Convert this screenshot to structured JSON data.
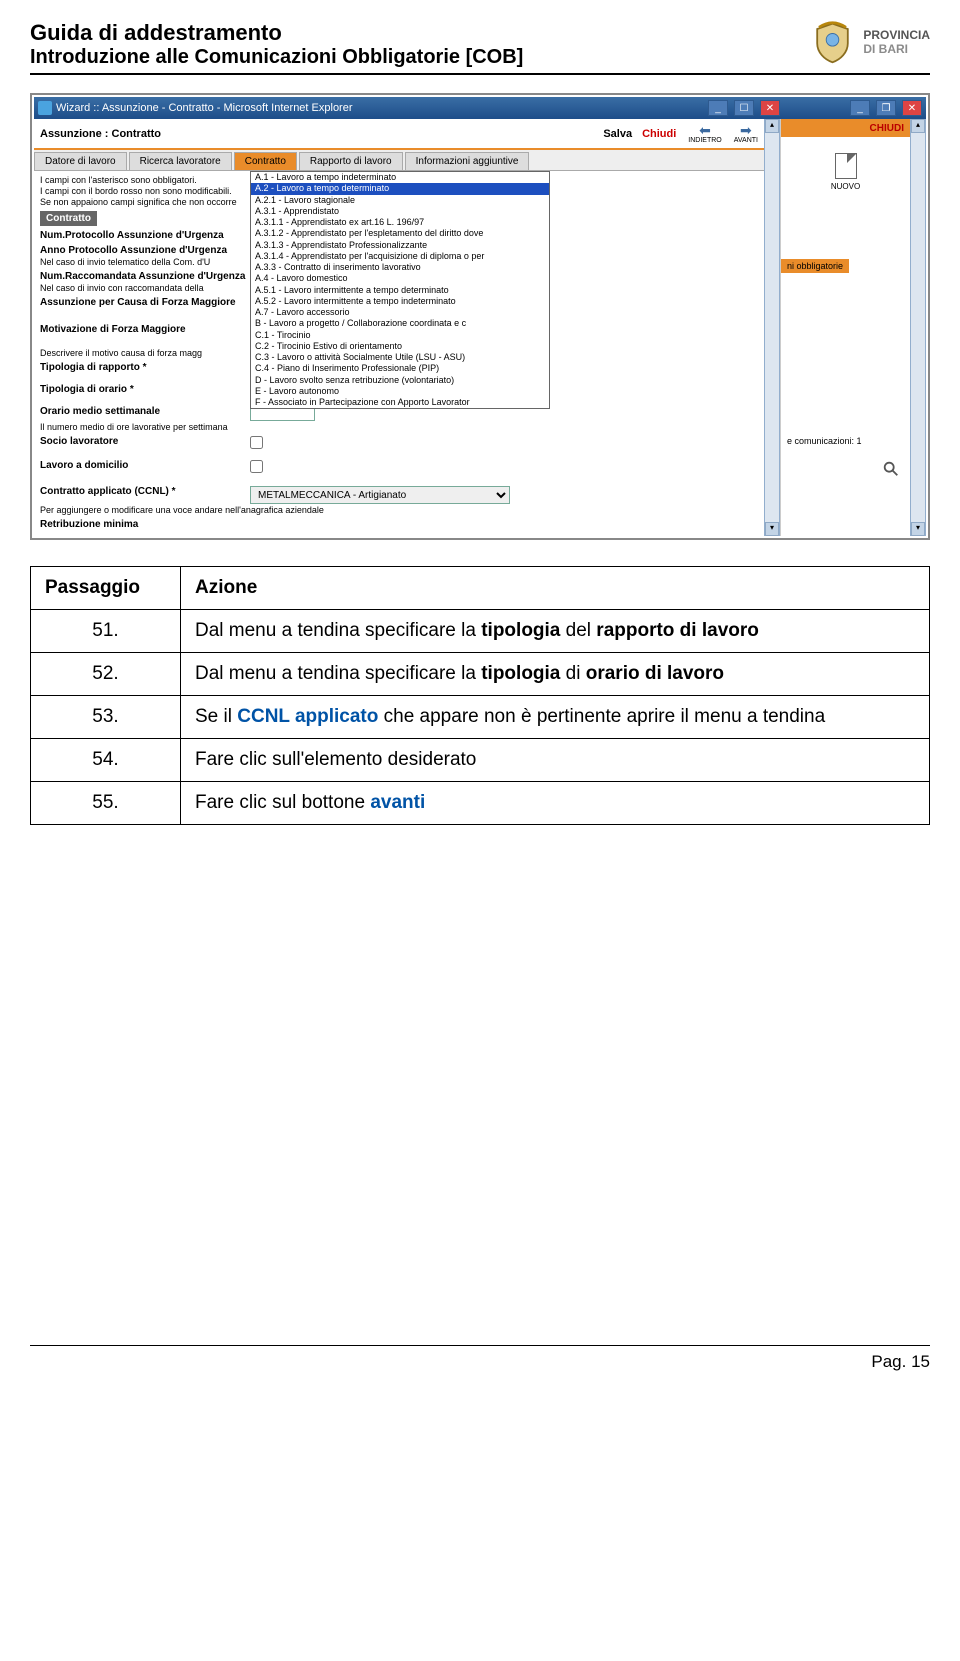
{
  "header": {
    "title": "Guida di addestramento",
    "subtitle": "Introduzione alle Comunicazioni Obbligatorie [COB]",
    "org_line1": "PROVINCIA",
    "org_line2": "DI BARI"
  },
  "screenshot": {
    "window_title": "Wizard :: Assunzione - Contratto - Microsoft Internet Explorer",
    "breadcrumb": "Assunzione : Contratto",
    "actions": {
      "salva": "Salva",
      "chiudi": "Chiudi",
      "indietro": "INDIETRO",
      "avanti": "AVANTI"
    },
    "tabs": [
      "Datore di lavoro",
      "Ricerca lavoratore",
      "Contratto",
      "Rapporto di lavoro",
      "Informazioni aggiuntive"
    ],
    "active_tab": "Contratto",
    "hints": [
      "I campi con l'asterisco sono obbligatori.",
      "I campi con il bordo rosso non sono modificabili.",
      "Se non appaiono campi significa che non occorre"
    ],
    "section": "Contratto",
    "fields": {
      "num_protocollo": {
        "label": "Num.Protocollo Assunzione d'Urgenza"
      },
      "anno_protocollo": {
        "label": "Anno Protocollo Assunzione d'Urgenza"
      },
      "note_telematico": "Nel caso di invio telematico della Com. d'U",
      "num_raccomandata": {
        "label": "Num.Raccomandata Assunzione d'Urgenza"
      },
      "note_raccomandata": "Nel caso di invio con raccomandata della",
      "forza_maggiore": {
        "label": "Assunzione per Causa di Forza Maggiore"
      },
      "motivazione": {
        "label": "Motivazione di Forza Maggiore"
      },
      "descrivere": "Descrivere il motivo causa di forza magg",
      "tipologia_rapporto": {
        "label": "Tipologia di rapporto *"
      },
      "tipologia_orario": {
        "label": "Tipologia di orario *"
      },
      "orario_medio": {
        "label": "Orario medio settimanale"
      },
      "orario_note": "Il numero medio di ore lavorative per settimana",
      "socio": {
        "label": "Socio lavoratore"
      },
      "domicilio": {
        "label": "Lavoro a domicilio"
      },
      "ccnl": {
        "label": "Contratto applicato (CCNL) *",
        "value": "METALMECCANICA - Artigianato"
      },
      "ccnl_note": "Per aggiungere o modificare una voce andare nell'anagrafica aziendale",
      "retribuzione": {
        "label": "Retribuzione minima"
      }
    },
    "dropdown_options": [
      "A.1 - Lavoro a tempo indeterminato",
      "A.2 - Lavoro a tempo determinato",
      "A.2.1 - Lavoro stagionale",
      "A.3.1 - Apprendistato",
      "A.3.1.1 - Apprendistato ex art.16 L. 196/97",
      "A.3.1.2 - Apprendistato per l'espletamento del diritto dove",
      "A.3.1.3 - Apprendistato Professionalizzante",
      "A.3.1.4 - Apprendistato per l'acquisizione di diploma o per",
      "A.3.3 - Contratto di inserimento lavorativo",
      "A.4 - Lavoro domestico",
      "A.5.1 - Lavoro intermittente a tempo determinato",
      "A.5.2 - Lavoro intermittente a tempo indeterminato",
      "A.7 - Lavoro accessorio",
      "B - Lavoro a progetto / Collaborazione coordinata e c",
      "C.1 - Tirocinio",
      "C.2 - Tirocinio Estivo di orientamento",
      "C.3 - Lavoro o attività Socialmente Utile (LSU - ASU)",
      "C.4 - Piano di Inserimento Professionale (PIP)",
      "D - Lavoro svolto senza retribuzione (volontariato)",
      "E - Lavoro autonomo",
      "F - Associato in Partecipazione con Apporto Lavorator"
    ],
    "dropdown_selected_index": 1,
    "right": {
      "chiudi": "CHIUDI",
      "nuovo": "NUOVO",
      "tag": "ni obbligatorie",
      "comms": "e comunicazioni: 1"
    }
  },
  "table": {
    "headers": {
      "col1": "Passaggio",
      "col2": "Azione"
    },
    "rows": [
      {
        "n": "51.",
        "pre": "Dal menu a tendina specificare la ",
        "b1": "tipologia",
        "mid": " del ",
        "b2": "rapporto di lavoro"
      },
      {
        "n": "52.",
        "pre": "Dal menu a tendina specificare la ",
        "b1": "tipologia",
        "mid": " di ",
        "b2": "orario di lavoro"
      },
      {
        "n": "53.",
        "pre": "Se il ",
        "c1": "CCNL applicato",
        "post": " che appare non è pertinente aprire il menu a tendina"
      },
      {
        "n": "54.",
        "pre": "Fare clic sull'elemento desiderato"
      },
      {
        "n": "55.",
        "pre": "Fare clic sul bottone ",
        "c1": "avanti"
      }
    ]
  },
  "footer": {
    "page": "Pag. 15"
  }
}
